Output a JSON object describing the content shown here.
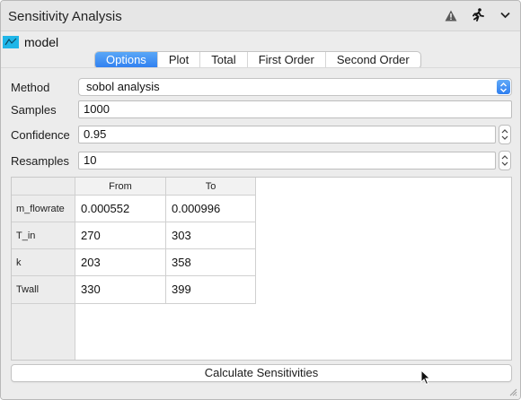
{
  "window": {
    "title": "Sensitivity Analysis",
    "icons": [
      "warning-icon",
      "running-man-icon",
      "chevron-down-icon"
    ]
  },
  "model": {
    "label": "model",
    "icon": "model-block-icon",
    "icon_color": "#1fb6e8"
  },
  "tabs": [
    {
      "label": "Options",
      "active": true
    },
    {
      "label": "Plot",
      "active": false
    },
    {
      "label": "Total",
      "active": false
    },
    {
      "label": "First Order",
      "active": false
    },
    {
      "label": "Second Order",
      "active": false
    }
  ],
  "form": {
    "method": {
      "label": "Method",
      "value": "sobol analysis"
    },
    "samples": {
      "label": "Samples",
      "value": "1000"
    },
    "confidence": {
      "label": "Confidence",
      "value": "0.95"
    },
    "resamples": {
      "label": "Resamples",
      "value": "10"
    }
  },
  "table": {
    "columns": [
      "From",
      "To"
    ],
    "rows": [
      {
        "name": "m_flowrate",
        "from": "0.000552",
        "to": "0.000996"
      },
      {
        "name": "T_in",
        "from": "270",
        "to": "303"
      },
      {
        "name": "k",
        "from": "203",
        "to": "358"
      },
      {
        "name": "Twall",
        "from": "330",
        "to": "399"
      }
    ]
  },
  "actions": {
    "calculate_label": "Calculate Sensitivities"
  },
  "colors": {
    "accent": "#2f7ff0",
    "window_bg": "#ececec"
  }
}
